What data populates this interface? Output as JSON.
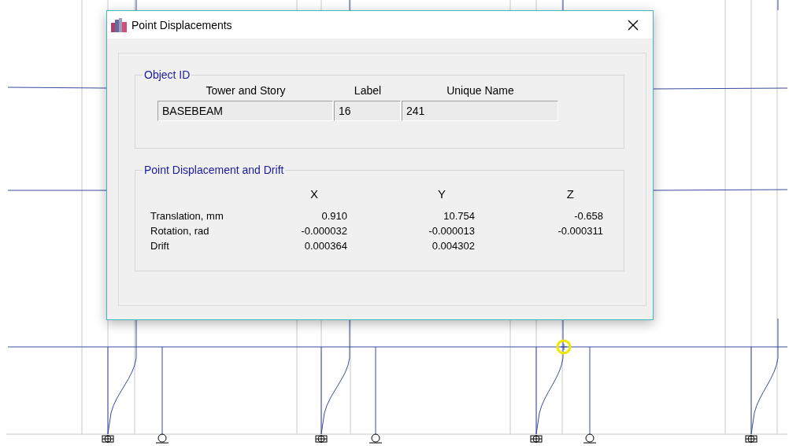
{
  "window": {
    "title": "Point Displacements"
  },
  "object_id": {
    "title": "Object ID",
    "columns": [
      "Tower and Story",
      "Label",
      "Unique Name"
    ],
    "values": [
      "BASEBEAM",
      "16",
      "241"
    ]
  },
  "displacement": {
    "title": "Point Displacement and Drift",
    "columns": [
      "X",
      "Y",
      "Z"
    ],
    "rows": [
      {
        "label": "Translation, mm",
        "values": [
          "0.910",
          "10.754",
          "-0.658"
        ]
      },
      {
        "label": "Rotation, rad",
        "values": [
          "-0.000032",
          "-0.000013",
          "-0.000311"
        ]
      },
      {
        "label": "Drift",
        "values": [
          "0.000364",
          "0.004302"
        ]
      }
    ]
  }
}
